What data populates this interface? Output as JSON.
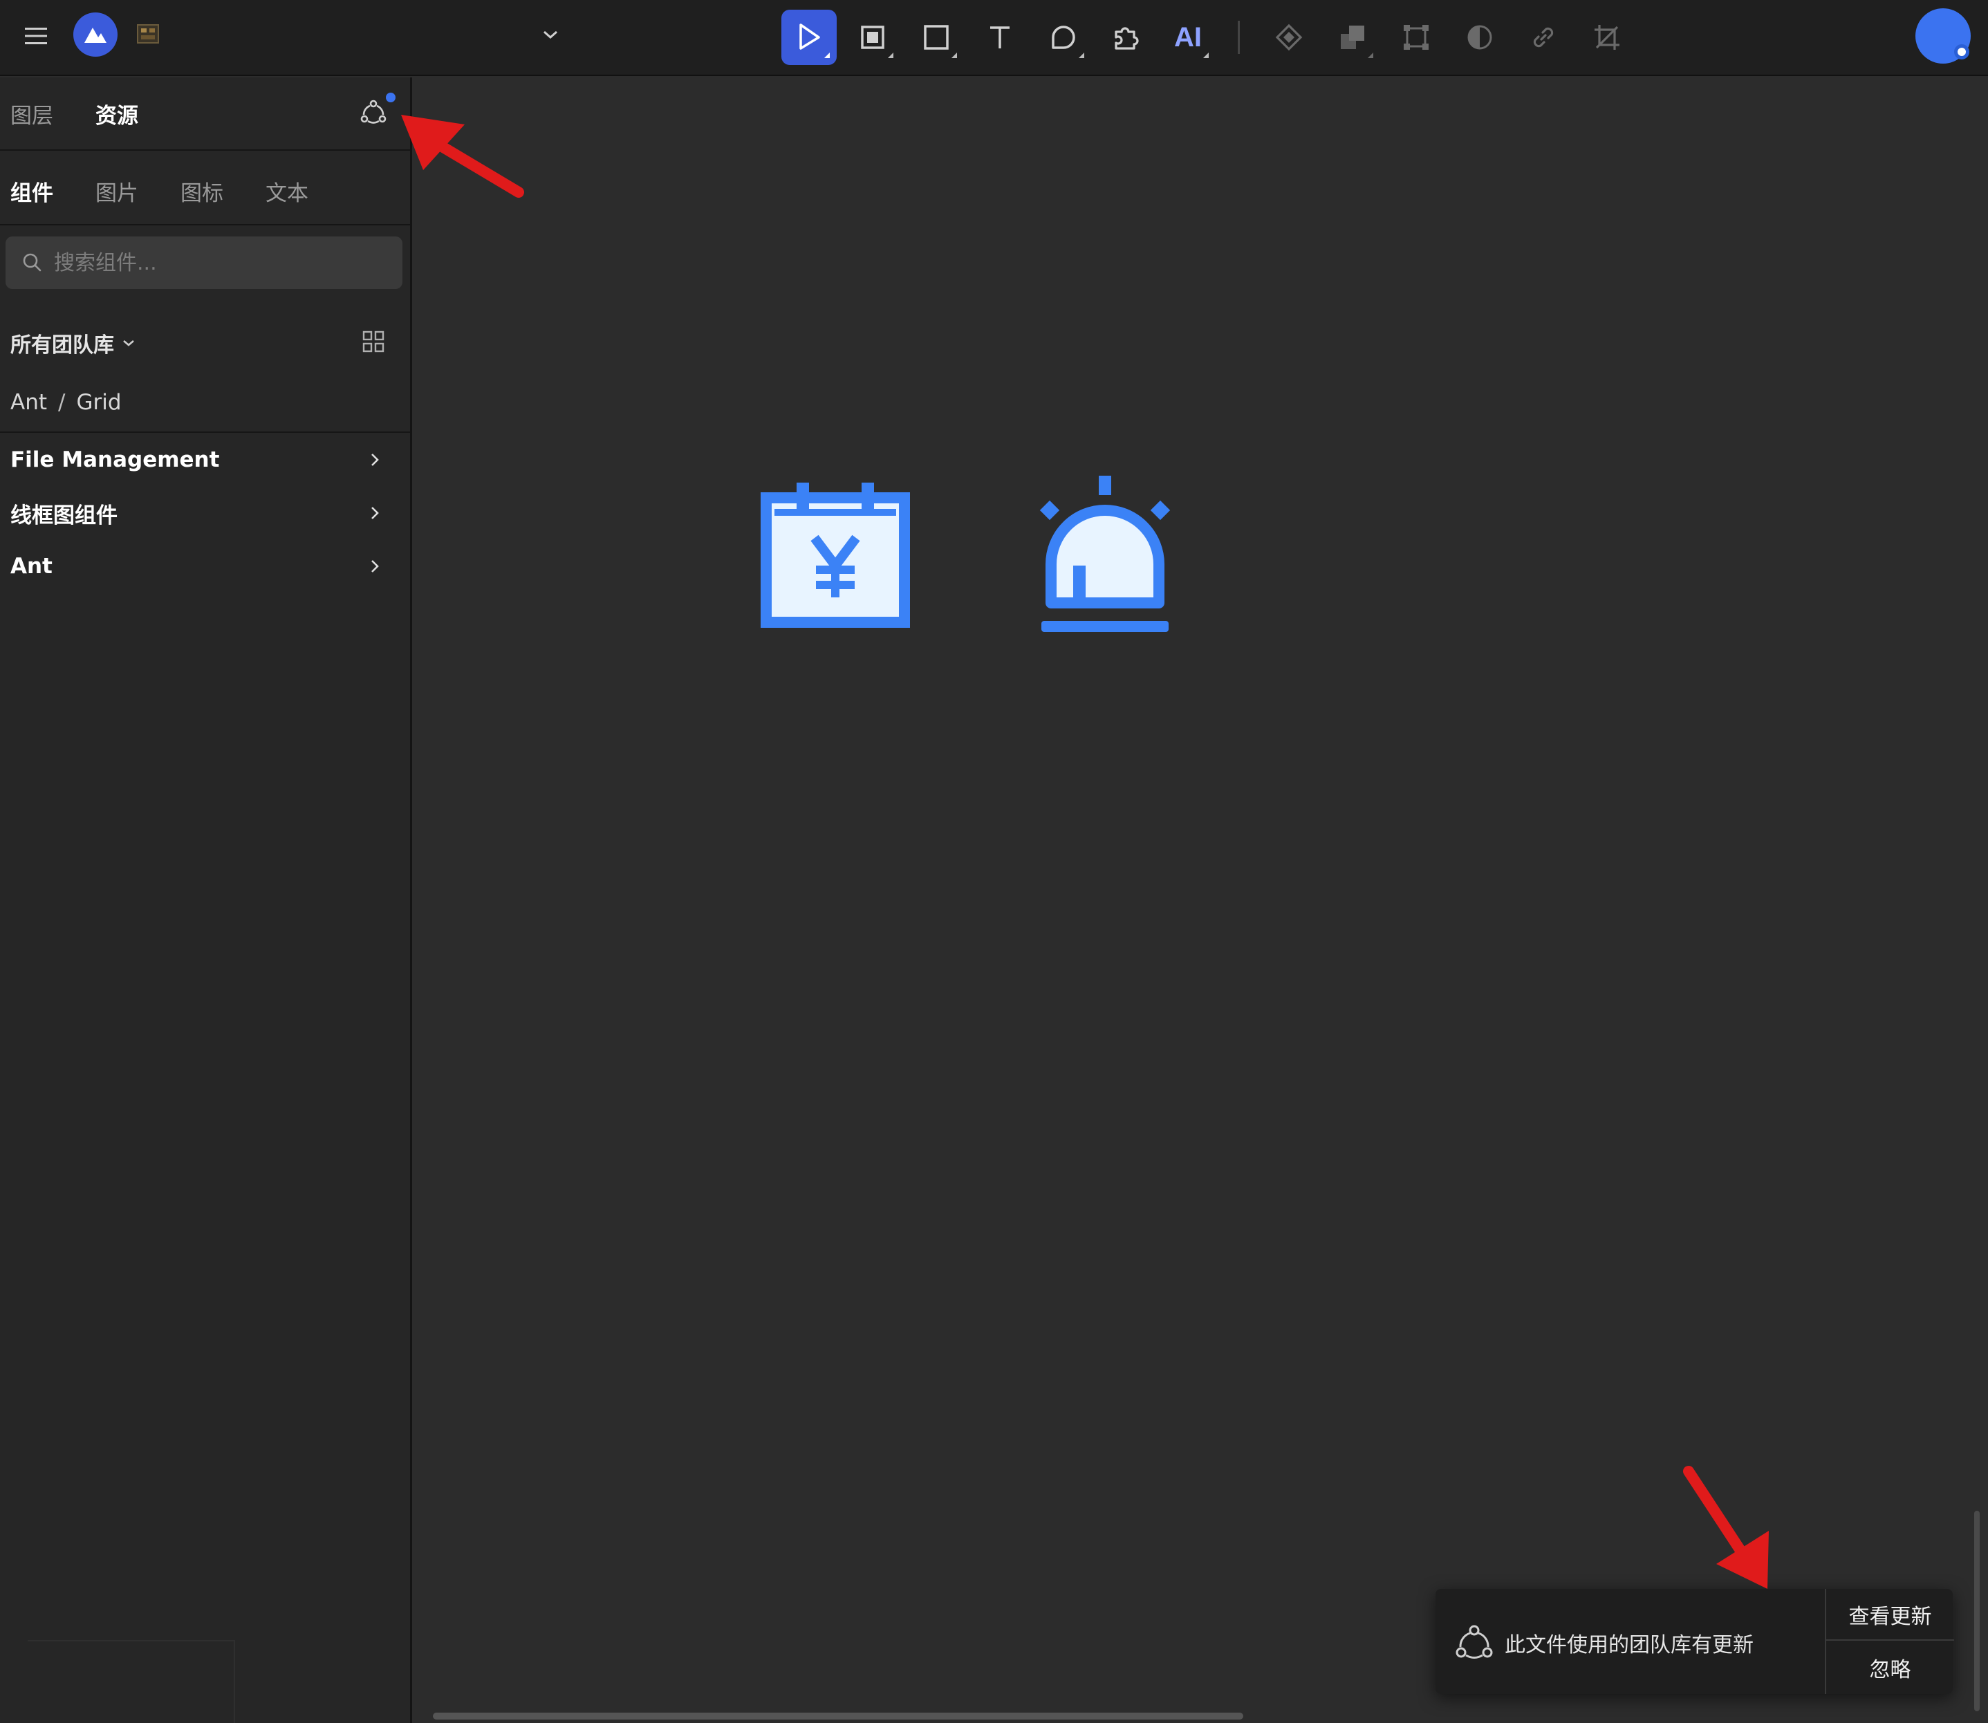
{
  "topbar": {
    "icons": [
      "menu-icon",
      "app-logo",
      "file-thumbnail",
      "chevron-down-icon"
    ],
    "tools": [
      {
        "name": "move-tool",
        "icon": "pointer-icon",
        "active": true
      },
      {
        "name": "frame-tool",
        "icon": "frame-icon",
        "active": false
      },
      {
        "name": "rectangle-tool",
        "icon": "rectangle-icon",
        "active": false
      },
      {
        "name": "text-tool",
        "icon": "text-icon",
        "active": false
      },
      {
        "name": "comment-tool",
        "icon": "comment-icon",
        "active": false
      },
      {
        "name": "plugin-tool",
        "icon": "puzzle-icon",
        "active": false
      },
      {
        "name": "ai-tool",
        "label": "AI",
        "active": false
      }
    ],
    "secondary_tools": [
      "component-icon",
      "boolean-icon",
      "transform-icon",
      "mask-icon",
      "link-icon",
      "crop-icon"
    ],
    "accent_color": "#3b5bdb"
  },
  "sidebar": {
    "panel_tabs": [
      {
        "label": "图层",
        "active": false
      },
      {
        "label": "资源",
        "active": true
      }
    ],
    "asset_tabs": [
      {
        "label": "组件",
        "active": true
      },
      {
        "label": "图片",
        "active": false
      },
      {
        "label": "图标",
        "active": false
      },
      {
        "label": "文本",
        "active": false
      }
    ],
    "search": {
      "placeholder": "搜索组件...",
      "value": ""
    },
    "library_select": {
      "label": "所有团队库"
    },
    "breadcrumb": [
      "Ant",
      "/",
      "Grid"
    ],
    "libraries": [
      {
        "label": "File Management"
      },
      {
        "label": "线框图组件"
      },
      {
        "label": "Ant"
      }
    ]
  },
  "canvas": {
    "icons": [
      "yuan-calendar-icon",
      "alarm-siren-icon"
    ],
    "icon_color": "#3b82f6",
    "icon_fill": "#e8f4ff"
  },
  "toast": {
    "message": "此文件使用的团队库有更新",
    "actions": [
      "查看更新",
      "忽略"
    ]
  },
  "annotation_color": "#e01b1b"
}
